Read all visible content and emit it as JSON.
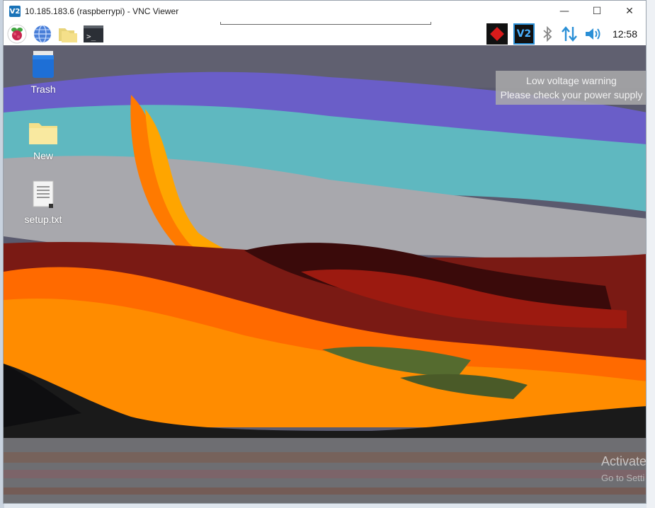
{
  "window": {
    "app_icon": "V2",
    "title": "10.185.183.6 (raspberrypi) - VNC Viewer",
    "controls": {
      "minimize": "—",
      "maximize": "☐",
      "close": "✕"
    }
  },
  "panel": {
    "launchers": [
      "raspberry-menu-icon",
      "web-browser-icon",
      "file-manager-icon",
      "terminal-icon"
    ],
    "terminal_glyph": ">_",
    "tray": [
      "power-warning-icon",
      "vnc-server-icon",
      "bluetooth-icon",
      "network-icon",
      "volume-icon"
    ],
    "vnc_label": "V2",
    "clock": "12:58"
  },
  "desktop": {
    "icons": [
      {
        "label": "Trash",
        "icon": "trash-icon"
      },
      {
        "label": "New",
        "icon": "folder-icon"
      },
      {
        "label": "setup.txt",
        "icon": "text-file-icon"
      }
    ]
  },
  "notification": {
    "line1": "Low voltage warning",
    "line2": "Please check your power supply"
  },
  "host": {
    "activate": "Activate",
    "goto": "Go to Setti"
  },
  "colors": {
    "vnc_blue": "#1a73b8",
    "tray_blue": "#2a8fd6",
    "warning_red": "#d81b1b"
  }
}
